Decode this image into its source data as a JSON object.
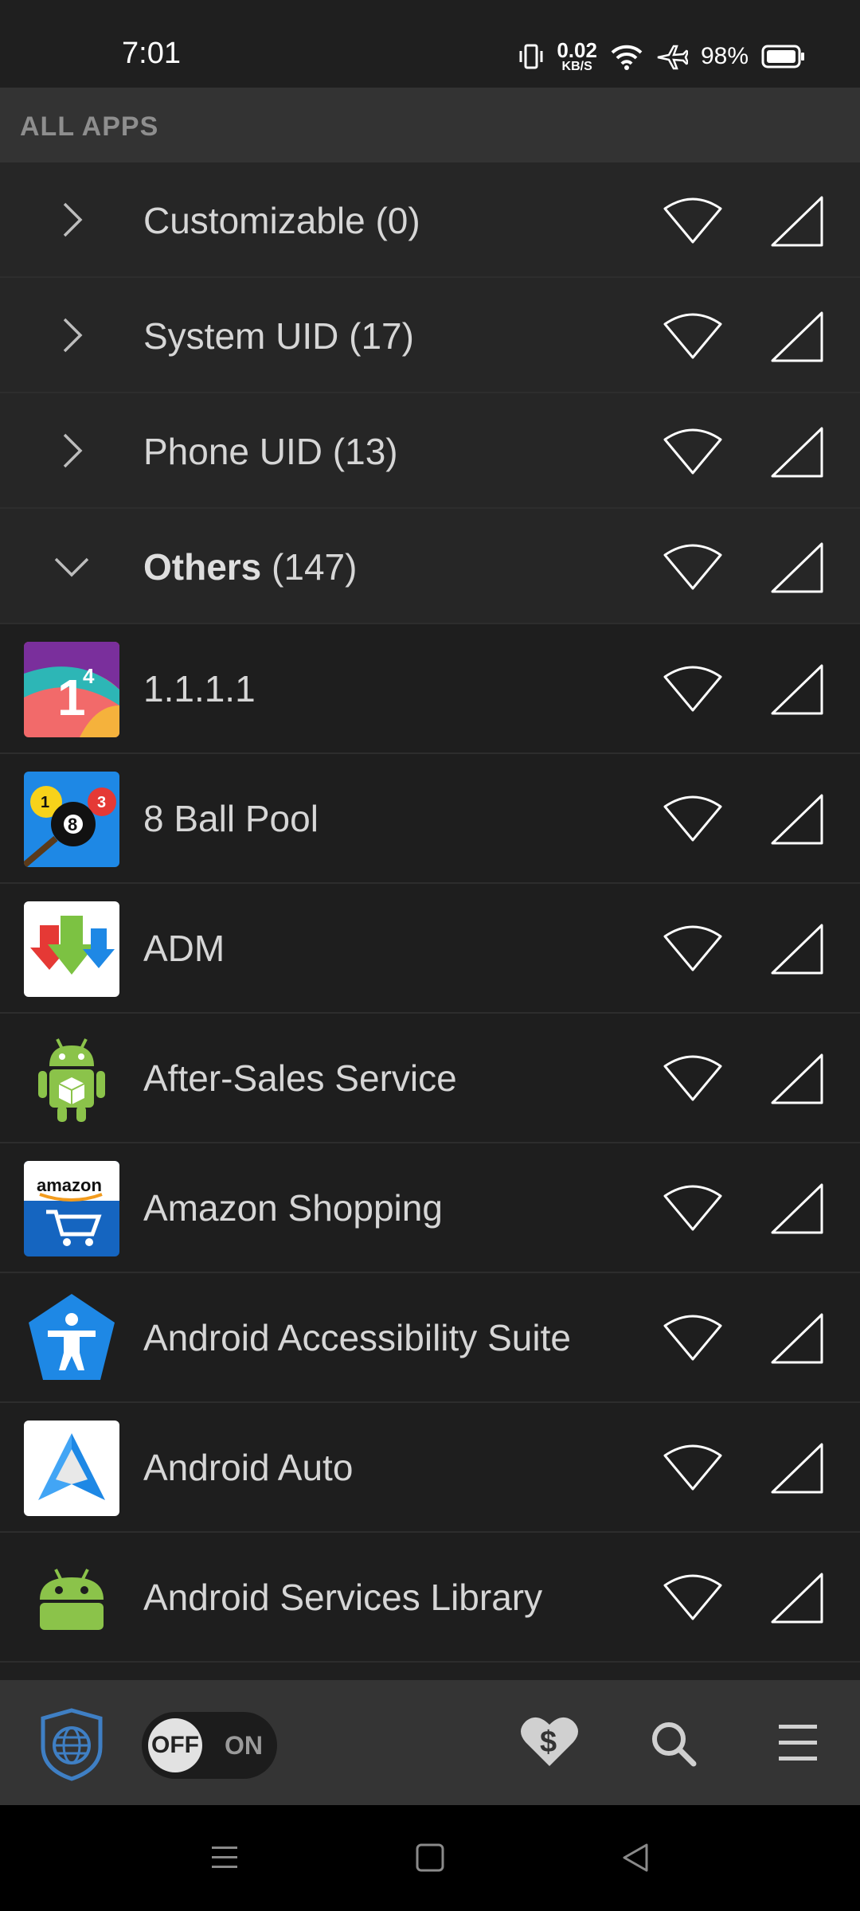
{
  "status_bar": {
    "time": "7:01",
    "net_speed_value": "0.02",
    "net_speed_unit": "KB/S",
    "battery_percent": "98%"
  },
  "section": {
    "title": "ALL APPS"
  },
  "groups": [
    {
      "name": "Customizable",
      "count": "(0)",
      "expanded": false
    },
    {
      "name": "System UID",
      "count": "(17)",
      "expanded": false
    },
    {
      "name": "Phone UID",
      "count": "(13)",
      "expanded": false
    },
    {
      "name": "Others",
      "count": "(147)",
      "expanded": true
    }
  ],
  "apps": [
    {
      "name": "1.1.1.1",
      "icon": "1.1.1.1-icon"
    },
    {
      "name": "8 Ball Pool",
      "icon": "8-ball-pool-icon"
    },
    {
      "name": "ADM",
      "icon": "adm-icon"
    },
    {
      "name": "After-Sales Service",
      "icon": "after-sales-service-icon"
    },
    {
      "name": "Amazon Shopping",
      "icon": "amazon-shopping-icon"
    },
    {
      "name": "Android Accessibility Suite",
      "icon": "accessibility-suite-icon"
    },
    {
      "name": "Android Auto",
      "icon": "android-auto-icon"
    },
    {
      "name": "Android Services Library",
      "icon": "android-services-library-icon"
    }
  ],
  "bottom_bar": {
    "toggle_off": "OFF",
    "toggle_on": "ON",
    "firewall_enabled": false
  },
  "icons": {
    "amazon_text": "amazon",
    "app_1111_badge": "1",
    "app_1111_sup": "4",
    "pool_ball_1": "1",
    "pool_ball_8": "8",
    "pool_ball_3": "3"
  },
  "colors": {
    "background": "#1f1f1f",
    "group_row": "#262626",
    "header": "#333333",
    "bottom_bar": "#343434",
    "accent_blue": "#2f6fb3"
  }
}
